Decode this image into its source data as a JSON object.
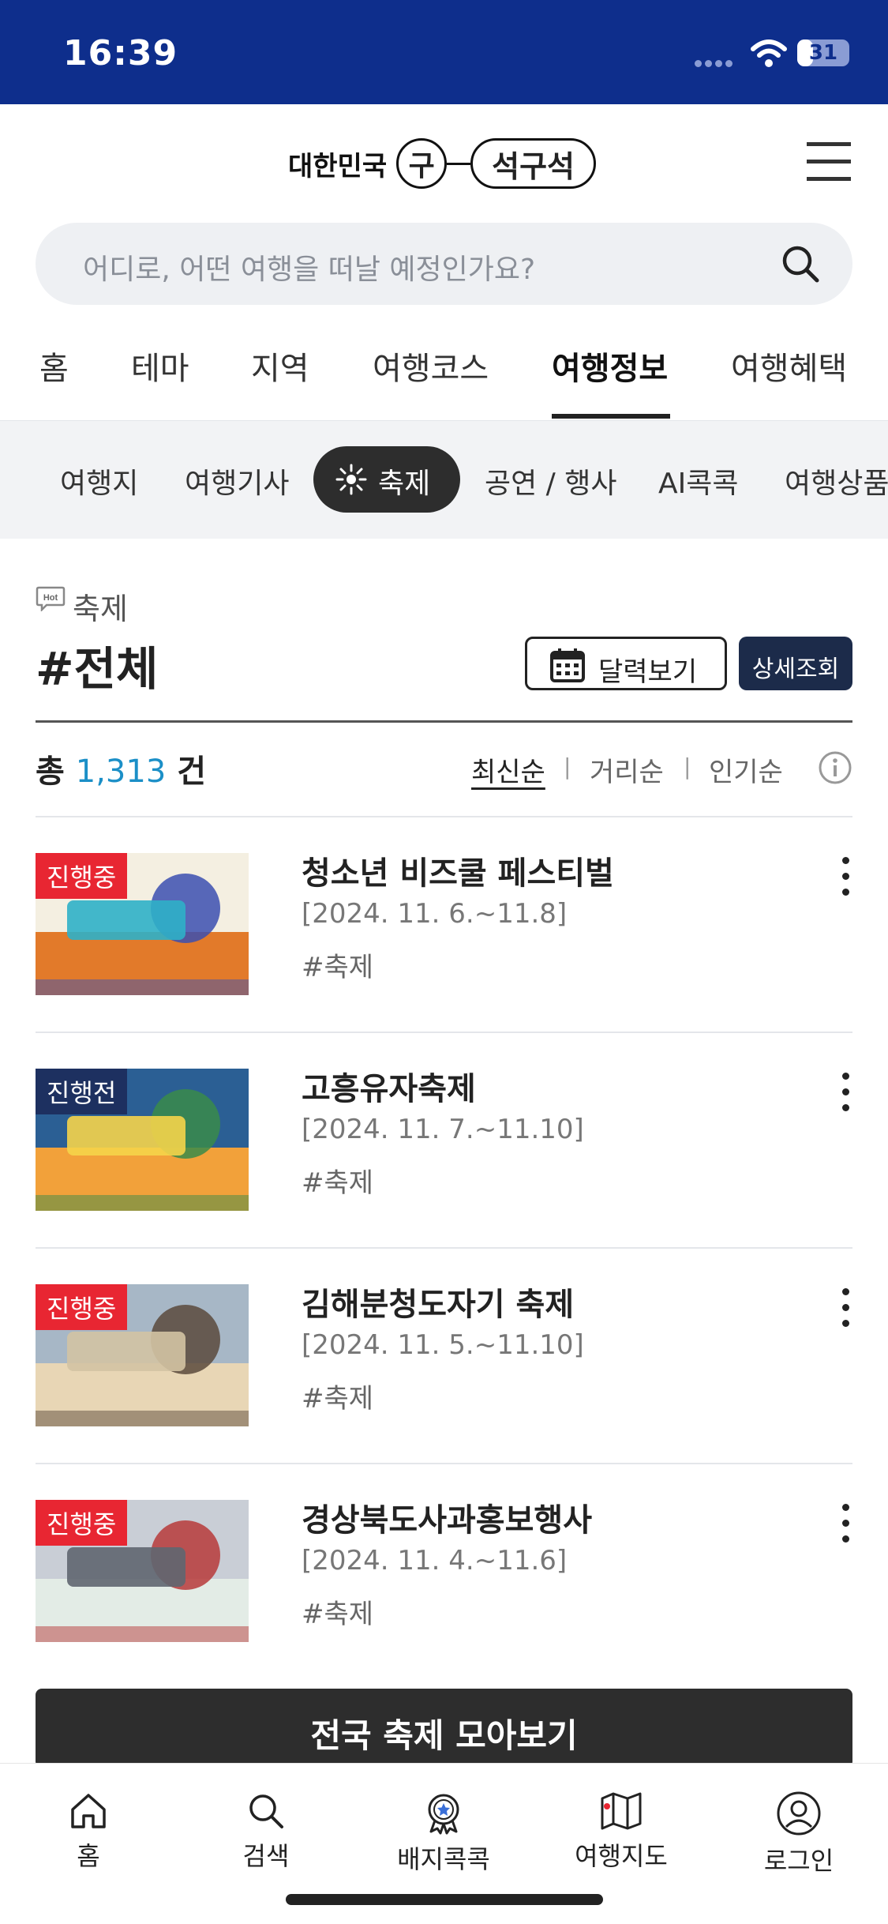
{
  "status_bar": {
    "time": "16:39",
    "battery": "31",
    "battery_level": 0.31
  },
  "header": {
    "logo_prefix": "대한민국",
    "logo_circle": "구",
    "logo_pill": "석구석",
    "search_placeholder": "어디로, 어떤 여행을 떠날 예정인가요?"
  },
  "gnb": [
    "홈",
    "테마",
    "지역",
    "여행코스",
    "여행정보",
    "여행혜택"
  ],
  "gnb_active": "여행정보",
  "subnav": {
    "items": [
      "여행지",
      "여행기사",
      "축제",
      "공연 / 행사",
      "AI콕콕",
      "여행상품"
    ],
    "active": "축제"
  },
  "section": {
    "hot_icon_text": "Hot",
    "subtitle": "축제",
    "title": "#전체",
    "calendar_button": "달력보기",
    "detail_button": "상세조회"
  },
  "summary": {
    "prefix": "총",
    "count": "1,313",
    "suffix": "건",
    "sort_options": [
      "최신순",
      "거리순",
      "인기순"
    ],
    "sort_active": "최신순"
  },
  "festivals": [
    {
      "status": "진행중",
      "status_type": "on",
      "title": "청소년 비즈쿨 페스티벌",
      "date": "[2024. 11. 6.~11.8]",
      "tag": "#축제",
      "thumb_colors": [
        "#f4efe1",
        "#e27a2a",
        "#3b4fb0",
        "#2fb0c8"
      ]
    },
    {
      "status": "진행전",
      "status_type": "pre",
      "title": "고흥유자축제",
      "date": "[2024. 11. 7.~11.10]",
      "tag": "#축제",
      "thumb_colors": [
        "#2b5f94",
        "#f2a13a",
        "#3a8b4a",
        "#f5d44a"
      ]
    },
    {
      "status": "진행중",
      "status_type": "on",
      "title": "김해분청도자기 축제",
      "date": "[2024. 11. 5.~11.10]",
      "tag": "#축제",
      "thumb_colors": [
        "#a7b7c6",
        "#e8d6b5",
        "#5b4a3c",
        "#d3c3a3"
      ]
    },
    {
      "status": "진행중",
      "status_type": "on",
      "title": "경상북도사과홍보행사",
      "date": "[2024. 11. 4.~11.6]",
      "tag": "#축제",
      "thumb_colors": [
        "#c9ced6",
        "#e3ece6",
        "#b73a3a",
        "#5f6670"
      ]
    }
  ],
  "all_button": "전국 축제 모아보기",
  "tabbar": [
    "홈",
    "검색",
    "배지콕콕",
    "여행지도",
    "로그인"
  ]
}
